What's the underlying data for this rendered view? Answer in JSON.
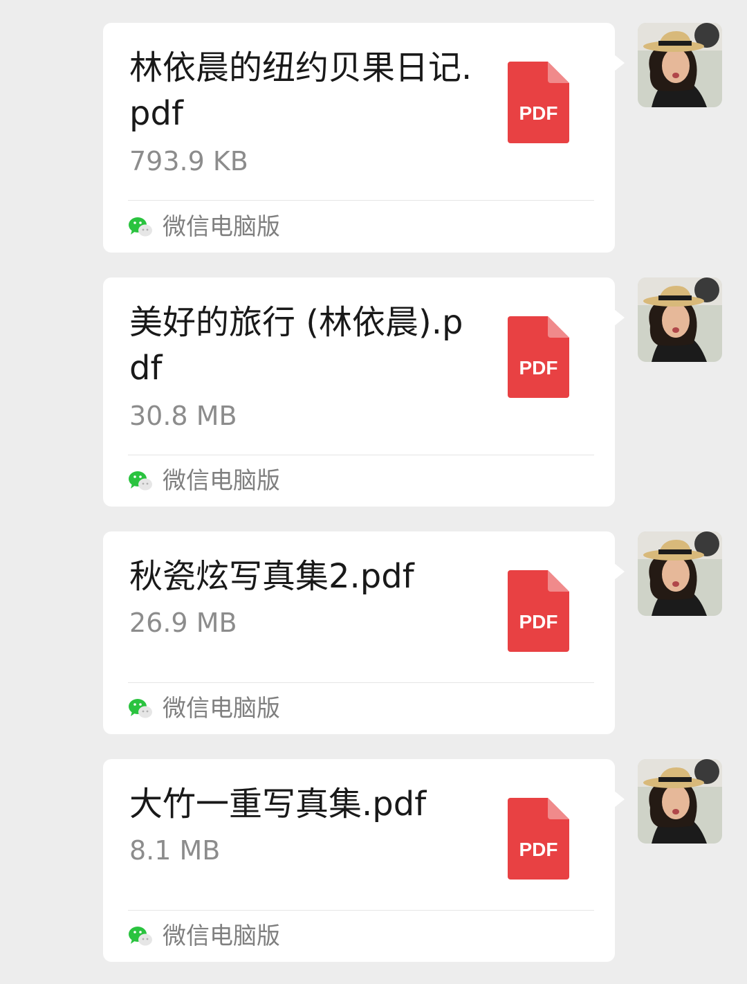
{
  "messages": [
    {
      "file_name": "林依晨的纽约贝果日记.pdf",
      "file_size": "793.9 KB",
      "file_type": "PDF",
      "source": "微信电脑版"
    },
    {
      "file_name": "美好的旅行 (林依晨).pdf",
      "file_size": "30.8 MB",
      "file_type": "PDF",
      "source": "微信电脑版"
    },
    {
      "file_name": "秋瓷炫写真集2.pdf",
      "file_size": "26.9 MB",
      "file_type": "PDF",
      "source": "微信电脑版"
    },
    {
      "file_name": "大竹一重写真集.pdf",
      "file_size": "8.1 MB",
      "file_type": "PDF",
      "source": "微信电脑版"
    }
  ],
  "colors": {
    "background": "#ededed",
    "bubble": "#ffffff",
    "pdf_red": "#e84143",
    "wechat_green": "#2ac33f",
    "secondary_text": "#8c8c8c"
  },
  "icons": {
    "file_type": "pdf-file-icon",
    "source": "wechat-icon",
    "sender": "avatar"
  }
}
